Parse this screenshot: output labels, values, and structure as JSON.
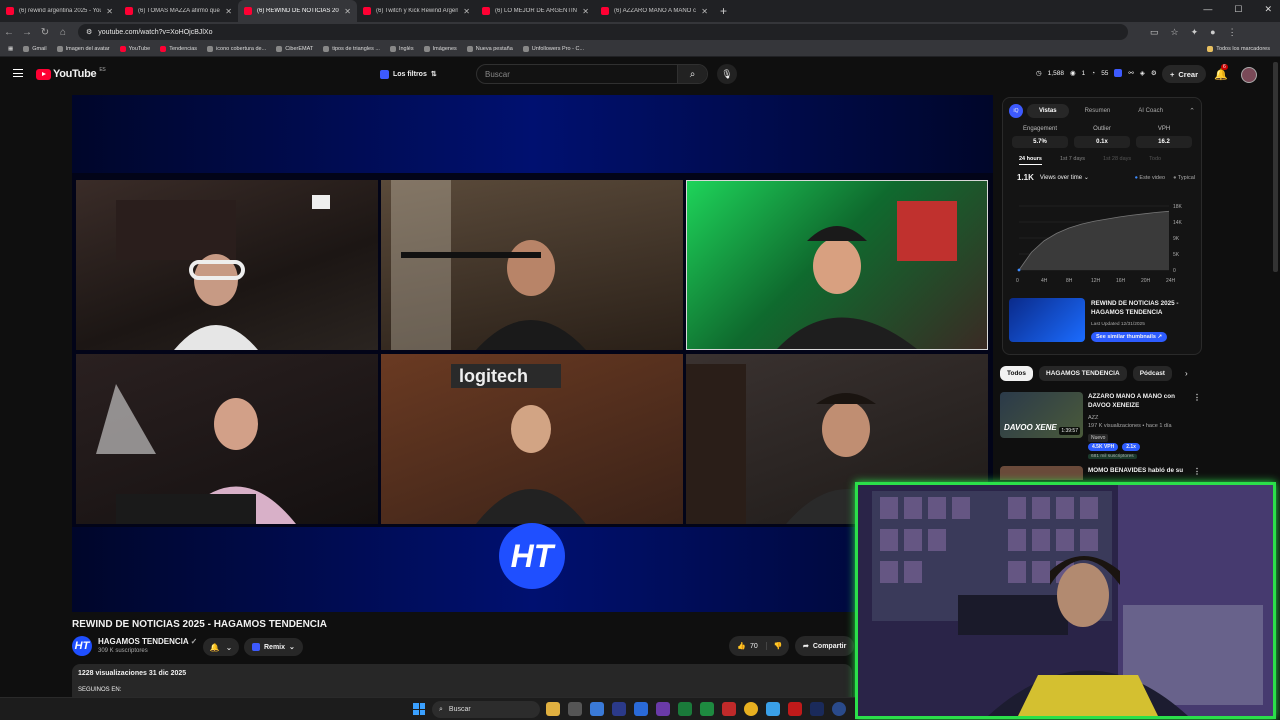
{
  "browser": {
    "tabs": [
      {
        "title": "(6) rewind argentina 2025 - YouTube",
        "active": false
      },
      {
        "title": "(6) TOMAS MAZZA afirmó que...",
        "active": false
      },
      {
        "title": "(6) REWIND DE NOTICIAS 2025",
        "active": true
      },
      {
        "title": "(6) Twitch y Kick Rewind Argentina",
        "active": false
      },
      {
        "title": "(6) LO MEJOR DE ARGENTINA",
        "active": false
      },
      {
        "title": "(6) AZZARO MANO A MANO con",
        "active": false
      }
    ],
    "url": "youtube.com/watch?v=XoHOjcBJlXo",
    "bookmarks": [
      "Gmail",
      "Imagen del avatar",
      "YouTube",
      "Tendencias",
      "icono cobertura de...",
      "CiberEMAT",
      "tipos de triangles ...",
      "Inglés",
      "Imágenes",
      "Nueva pestaña",
      "Unfollowers Pro - C..."
    ],
    "all_bookmarks": "Todos los marcadores"
  },
  "header": {
    "logo": "YouTube",
    "region": "ES",
    "filters_label": "Los filtros",
    "search_placeholder": "Buscar",
    "stats": [
      "1,588",
      "1",
      "55"
    ],
    "create_label": "Crear",
    "notifications": "6"
  },
  "video": {
    "title": "REWIND DE NOTICIAS 2025 - HAGAMOS TENDENCIA",
    "channel": "HAGAMOS TENDENCIA",
    "subscribers": "309 K suscriptores",
    "remix_label": "Remix",
    "likes": "70",
    "share_label": "Compartir",
    "views_date": "1228 visualizaciones  31 dic 2025",
    "desc_line": "SEGUINOS EN:",
    "logo_text": "HT"
  },
  "panel": {
    "tabs": [
      "Vistas",
      "Resumen",
      "AI Coach"
    ],
    "icon": "iQ",
    "metrics": [
      {
        "label": "Engagement",
        "value": "5.7%"
      },
      {
        "label": "Outlier",
        "value": "0.1x"
      },
      {
        "label": "VPH",
        "value": "16.2"
      }
    ],
    "ranges": [
      "24 hours",
      "1st 7 days",
      "1st 28 days",
      "Todo"
    ],
    "views_total": "1.1K",
    "views_dropdown": "Views over time",
    "legend": [
      "Este video",
      "Typical"
    ],
    "y_ticks": [
      "18K",
      "14K",
      "9K",
      "5K",
      "0"
    ],
    "x_ticks": [
      "0",
      "4H",
      "8H",
      "12H",
      "16H",
      "20H",
      "24H"
    ],
    "reco_title": "REWIND DE NOTICIAS 2025 - HAGAMOS TENDENCIA",
    "reco_updated": "Last Updated 12/31/2025",
    "reco_button": "See similar thumbnails"
  },
  "chart_data": {
    "type": "area",
    "title": "",
    "xlabel": "",
    "ylabel": "",
    "x": [
      0,
      2,
      4,
      6,
      8,
      10,
      12,
      14,
      16,
      18,
      20,
      22,
      24
    ],
    "series": [
      {
        "name": "Typical",
        "values": [
          0,
          5000,
          8200,
          10300,
          11800,
          12900,
          13700,
          14300,
          14900,
          15400,
          15800,
          16200,
          16500
        ]
      }
    ],
    "ylim": [
      0,
      18000
    ],
    "grid": true
  },
  "chips": [
    "Todos",
    "HAGAMOS TENDENCIA",
    "Pódcast"
  ],
  "recs": [
    {
      "title": "AZZARO MANO A MANO con DAVOO XENEIZE",
      "author": "AZZ",
      "views": "197 K visualizaciones • hace 1 día",
      "new_badge": "Nuevo",
      "vph": "4.5K VPH",
      "outlier": "2.1x",
      "subs": "681 mil suscriptores",
      "duration": "1:39:57",
      "overlay": "DAVOO XENE"
    },
    {
      "title": "MOMO BENAVIDES habló de su"
    }
  ],
  "taskbar": {
    "search": "Buscar"
  }
}
